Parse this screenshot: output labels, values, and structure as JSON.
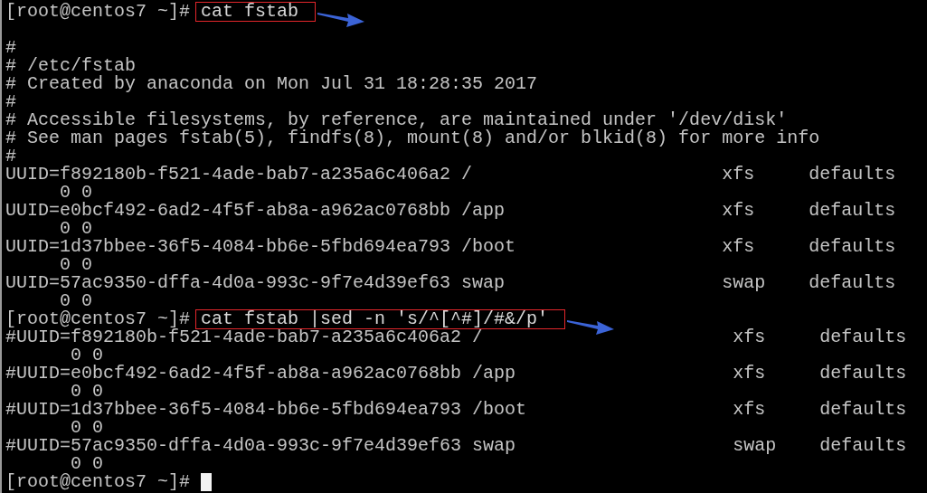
{
  "terminal": {
    "lines": [
      {
        "kind": "prompt",
        "prompt": "[root@centos7 ~]#",
        "command": "cat fstab",
        "annotated": true
      },
      {
        "kind": "blank"
      },
      {
        "kind": "output",
        "text": "#"
      },
      {
        "kind": "output",
        "text": "# /etc/fstab"
      },
      {
        "kind": "output",
        "text": "# Created by anaconda on Mon Jul 31 18:28:35 2017"
      },
      {
        "kind": "output",
        "text": "#"
      },
      {
        "kind": "output",
        "text": "# Accessible filesystems, by reference, are maintained under '/dev/disk'"
      },
      {
        "kind": "output",
        "text": "# See man pages fstab(5), findfs(8), mount(8) and/or blkid(8) for more info"
      },
      {
        "kind": "output",
        "text": "#"
      },
      {
        "kind": "entry",
        "device": "UUID=f892180b-f521-4ade-bab7-a235a6c406a2",
        "mount": "/",
        "fstype": "xfs",
        "options": "defaults",
        "dump": "0",
        "pass": "0"
      },
      {
        "kind": "entry",
        "device": "UUID=e0bcf492-6ad2-4f5f-ab8a-a962ac0768bb",
        "mount": "/app",
        "fstype": "xfs",
        "options": "defaults",
        "dump": "0",
        "pass": "0"
      },
      {
        "kind": "entry",
        "device": "UUID=1d37bbee-36f5-4084-bb6e-5fbd694ea793",
        "mount": "/boot",
        "fstype": "xfs",
        "options": "defaults",
        "dump": "0",
        "pass": "0"
      },
      {
        "kind": "entry",
        "device": "UUID=57ac9350-dffa-4d0a-993c-9f7e4d39ef63",
        "mount": "swap",
        "fstype": "swap",
        "options": "defaults",
        "dump": "0",
        "pass": "0"
      },
      {
        "kind": "prompt",
        "prompt": "[root@centos7 ~]#",
        "command": "cat fstab |sed -n 's/^[^#]/#&/p'",
        "annotated": true
      },
      {
        "kind": "commented-entry",
        "device": "#UUID=f892180b-f521-4ade-bab7-a235a6c406a2",
        "mount": "/",
        "fstype": "xfs",
        "options": "defaults",
        "dump": "0",
        "pass": "0"
      },
      {
        "kind": "commented-entry",
        "device": "#UUID=e0bcf492-6ad2-4f5f-ab8a-a962ac0768bb",
        "mount": "/app",
        "fstype": "xfs",
        "options": "defaults",
        "dump": "0",
        "pass": "0"
      },
      {
        "kind": "commented-entry",
        "device": "#UUID=1d37bbee-36f5-4084-bb6e-5fbd694ea793",
        "mount": "/boot",
        "fstype": "xfs",
        "options": "defaults",
        "dump": "0",
        "pass": "0"
      },
      {
        "kind": "commented-entry",
        "device": "#UUID=57ac9350-dffa-4d0a-993c-9f7e4d39ef63",
        "mount": "swap",
        "fstype": "swap",
        "options": "defaults",
        "dump": "0",
        "pass": "0"
      },
      {
        "kind": "prompt",
        "prompt": "[root@centos7 ~]#",
        "cursor": true
      }
    ]
  }
}
